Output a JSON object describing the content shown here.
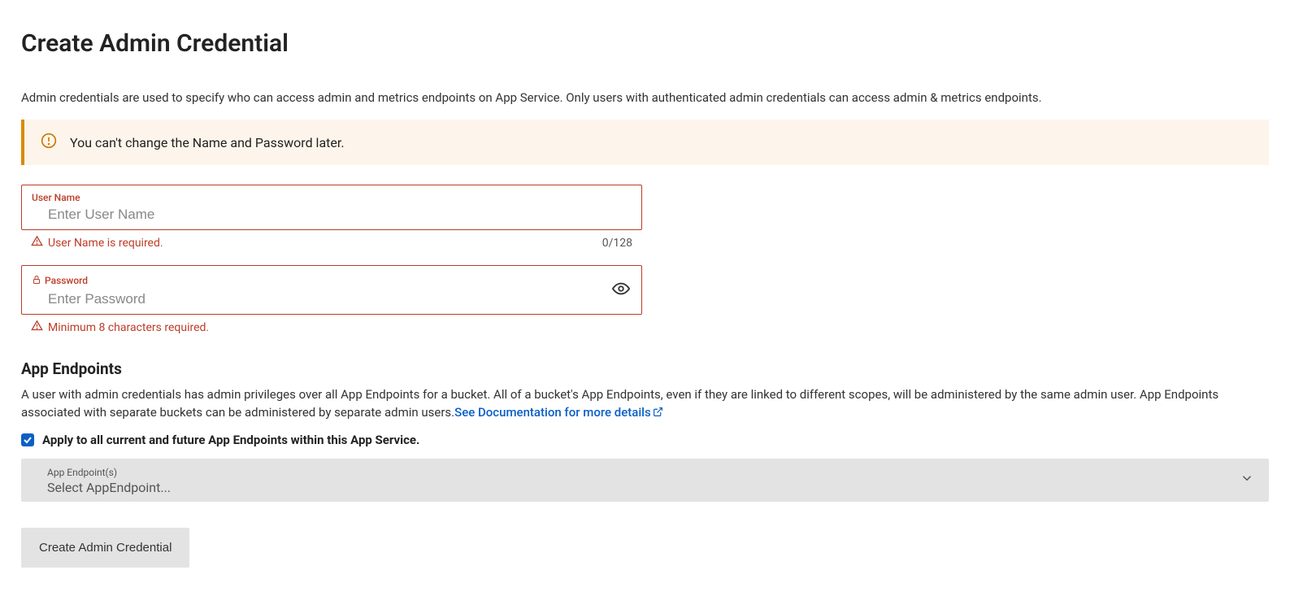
{
  "title": "Create Admin Credential",
  "intro": "Admin credentials are used to specify who can access admin and metrics endpoints on App Service. Only users with authenticated admin credentials can access admin & metrics endpoints.",
  "warning": "You can't change the Name and Password later.",
  "username": {
    "label": "User Name",
    "placeholder": "Enter User Name",
    "value": "",
    "error": "User Name is required.",
    "counter": "0/128"
  },
  "password": {
    "label": "Password",
    "placeholder": "Enter Password",
    "value": "",
    "error": "Minimum 8 characters required."
  },
  "endpoints": {
    "heading": "App Endpoints",
    "description": "A user with admin credentials has admin privileges over all App Endpoints for a bucket. All of a bucket's App Endpoints, even if they are linked to different scopes, will be administered by the same admin user. App Endpoints associated with separate buckets can be administered by separate admin users.",
    "doc_link": "See Documentation for more details",
    "apply_all_label": "Apply to all current and future App Endpoints within this App Service.",
    "apply_all_checked": true,
    "select": {
      "label": "App Endpoint(s)",
      "placeholder": "Select AppEndpoint..."
    }
  },
  "submit_label": "Create Admin Credential"
}
